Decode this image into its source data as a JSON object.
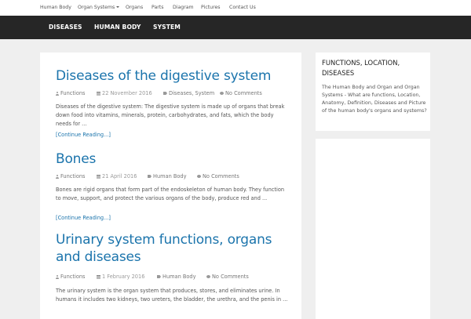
{
  "top_nav": {
    "items": [
      {
        "label": "Human Body"
      },
      {
        "label": "Organ Systems"
      },
      {
        "label": "Organs"
      },
      {
        "label": "Parts"
      },
      {
        "label": "Diagram"
      },
      {
        "label": "Pictures"
      },
      {
        "label": "Contact Us"
      }
    ]
  },
  "main_nav": {
    "items": [
      {
        "label": "DISEASES"
      },
      {
        "label": "HUMAN BODY"
      },
      {
        "label": "SYSTEM"
      }
    ]
  },
  "posts": [
    {
      "title": "Diseases of the digestive system",
      "author": "Functions",
      "date": "22 November 2016",
      "categories": "Diseases, System",
      "comments": "No Comments",
      "excerpt": "Diseases of the digestive system: The digestive system is made up of organs that break down food into vitamins, minerals, protein, carbohydrates, and fats, which the body needs for ...",
      "more": "[Continue Reading...]"
    },
    {
      "title": "Bones",
      "author": "Functions",
      "date": "21 April 2016",
      "categories": "Human Body",
      "comments": "No Comments",
      "excerpt": "Bones are rigid organs that form part of the endoskeleton of human body. They function to move, support, and protect the various organs of the body, produce red and ...",
      "more": "[Continue Reading...]"
    },
    {
      "title": "Urinary system functions, organs and diseases",
      "author": "Functions",
      "date": "1 February 2016",
      "categories": "Human Body",
      "comments": "No Comments",
      "excerpt": "The urinary system is the organ system that produces, stores, and eliminates urine. In humans it includes two kidneys, two ureters, the bladder, the urethra, and the penis in ..."
    }
  ],
  "sidebar": {
    "widget_title": "FUNCTIONS, LOCATION, DISEASES",
    "widget_text": "The Human Body and Organ and Organ Systems - What are functions, Location, Anatomy, Definition, Diseases and Picture of the human body's organs and systems?"
  }
}
